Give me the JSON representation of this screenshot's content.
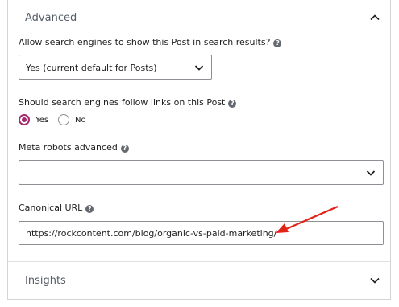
{
  "advanced": {
    "title": "Advanced",
    "toggle_icon": "chevron-up-icon",
    "search_results_label": "Allow search engines to show this Post in search results?",
    "search_results_value": "Yes (current default for Posts)",
    "follow_links_label": "Should search engines follow links on this Post",
    "follow_yes": "Yes",
    "follow_no": "No",
    "follow_selected": "Yes",
    "meta_robots_label": "Meta robots advanced",
    "meta_robots_value": "",
    "canonical_label": "Canonical URL",
    "canonical_value": "https://rockcontent.com/blog/organic-vs-paid-marketing/"
  },
  "insights": {
    "title": "Insights",
    "toggle_icon": "chevron-down-icon"
  },
  "help_icon": "help-icon",
  "colors": {
    "accent": "#a4286a",
    "annotation_arrow": "#e2231a"
  }
}
